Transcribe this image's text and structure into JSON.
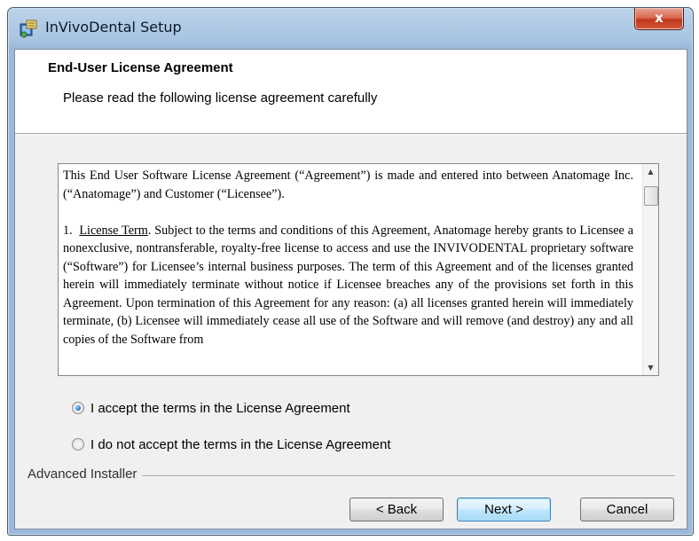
{
  "window": {
    "title": "InVivoDental Setup",
    "close_glyph": "x"
  },
  "header": {
    "title": "End-User License Agreement",
    "subtitle": "Please read the following license agreement carefully"
  },
  "license": {
    "paragraph1": "This End User Software License Agreement (“Agreement”) is made and entered into between Anatomage Inc. (“Anatomage”) and Customer  (“Licensee”).",
    "section1_number": "1.",
    "section1_heading": "License Term",
    "section1_body": ".  Subject to the terms and conditions of this Agreement, Anatomage hereby grants to Licensee a nonexclusive, nontransferable, royalty-free license to access and use the INVIVODENTAL proprietary software (“Software”) for Licensee’s internal business purposes.  The term of this Agreement and of the licenses granted herein will immediately terminate without notice if Licensee breaches any of the provisions set forth in this Agreement.  Upon termination of this Agreement for any reason: (a) all licenses granted herein will immediately terminate, (b) Licensee will immediately cease all use of the Software and will remove (and destroy) any and all copies of the Software from"
  },
  "options": {
    "accept_label": "I accept the terms in the License Agreement",
    "decline_label": "I do not accept the terms in the License Agreement",
    "selected": "accept"
  },
  "footer": {
    "brand": "Advanced Installer",
    "back_label": "< Back",
    "next_label": "Next >",
    "cancel_label": "Cancel"
  },
  "icons": {
    "app": "installer-package-icon",
    "scroll_up": "scroll-up-arrow-icon",
    "scroll_down": "scroll-down-arrow-icon"
  },
  "colors": {
    "title_bar": "#a9c5e2",
    "close_button": "#c0391b",
    "default_button_border": "#3c7fb1",
    "radio_checked": "#2e7cd0"
  }
}
